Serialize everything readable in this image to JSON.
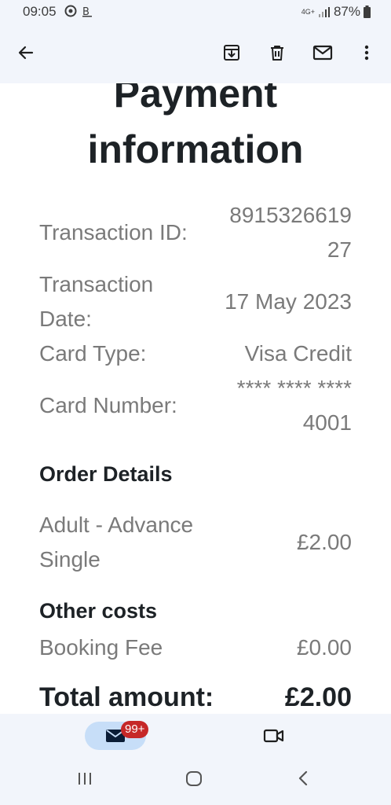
{
  "status": {
    "time": "09:05",
    "network": "4G+",
    "battery": "87%"
  },
  "toolbar": {
    "icons": [
      "back-arrow-icon",
      "archive-icon",
      "delete-icon",
      "mark-unread-icon",
      "more-vert-icon"
    ]
  },
  "email": {
    "title_line1": "Payment",
    "title_line2": "information",
    "transaction_id_label": "Transaction ID:",
    "transaction_id_value_1": "8915326619",
    "transaction_id_value_2": "27",
    "transaction_date_label_1": "Transaction",
    "transaction_date_label_2": "Date:",
    "transaction_date_value": "17 May 2023",
    "card_type_label": "Card Type:",
    "card_type_value": "Visa Credit",
    "card_number_label": "Card Number:",
    "card_number_value_1": "**** **** ****",
    "card_number_value_2": "4001",
    "order_details_heading": "Order Details",
    "order_item_label_1": "Adult - Advance",
    "order_item_label_2": "Single",
    "order_item_value": "£2.00",
    "other_costs_heading": "Other costs",
    "booking_fee_label": "Booking Fee",
    "booking_fee_value": "£0.00",
    "total_label": "Total amount:",
    "total_value": "£2.00"
  },
  "bottom_nav": {
    "mail_badge": "99+"
  },
  "colors": {
    "bar_bg": "#f2f5fb",
    "pill": "#c7def8",
    "badge": "#c62828"
  }
}
